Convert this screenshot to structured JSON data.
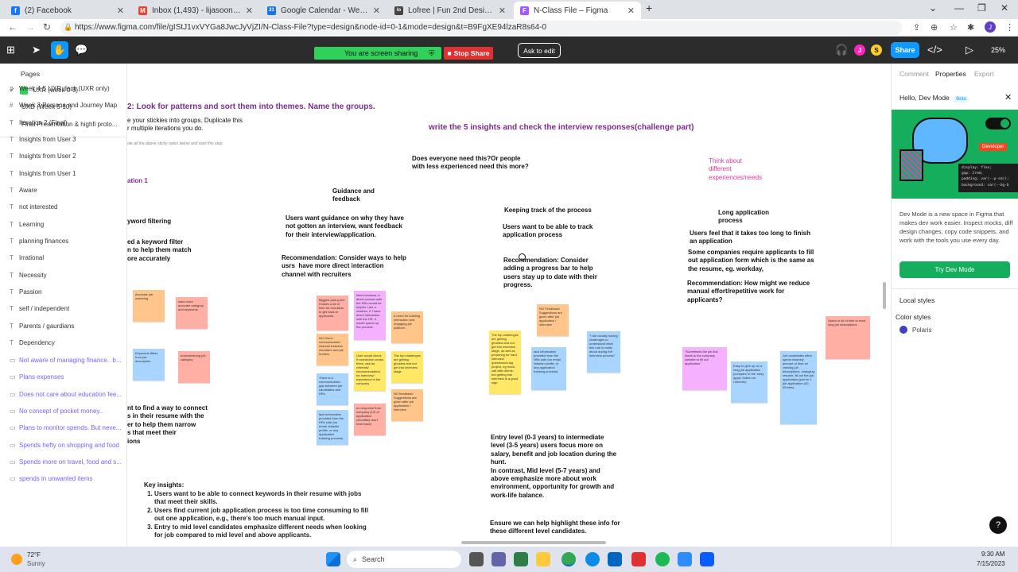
{
  "browser": {
    "tabs": [
      {
        "title": "(2) Facebook",
        "fav_color": "#1877f2",
        "fav_glyph": "f"
      },
      {
        "title": "Inbox (1,493) - lijasoon@gmail.c",
        "fav_color": "#ea4335",
        "fav_glyph": "M"
      },
      {
        "title": "Google Calendar - Week of July",
        "fav_color": "#1a73e8",
        "fav_glyph": "31"
      },
      {
        "title": "Lofree | Fun 2nd Designer for Mec",
        "fav_color": "#444444",
        "fav_glyph": "lo"
      },
      {
        "title": "N-Class File – Figma",
        "fav_color": "#a259ff",
        "fav_glyph": "F",
        "active": true
      }
    ],
    "new_tab": "+",
    "url": "https://www.figma.com/file/gIStJ1vxVYGa8JwcJyVjZI/N-Class-File?type=design&node-id=0-1&mode=design&t=B9FgXE94lzaR8s64-0",
    "profile_initial": "J"
  },
  "toolbar": {
    "screen_sharing": "You are screen sharing",
    "stop_share": "Stop Share",
    "ask_to_edit": "Ask to edit",
    "avatars": [
      {
        "initial": "J",
        "color": "#ff24bd"
      },
      {
        "initial": "S",
        "color": "#ffcd29"
      }
    ],
    "share": "Share",
    "zoom": "25%"
  },
  "pages": {
    "header": "Pages",
    "items": [
      {
        "label": "UXR (week 0-5)",
        "current": true
      },
      {
        "label": "UXD (Week 5-10)"
      },
      {
        "label": "Final Presentation & highfi proto..."
      }
    ]
  },
  "layers": [
    {
      "label": "Week 4-5 UXR deck (UXR only)",
      "icon": "#",
      "purple": false
    },
    {
      "label": "Week 3 Persona and Journey Map",
      "icon": "#",
      "purple": false
    },
    {
      "label": "Iteration 2 (Final)",
      "icon": "T",
      "purple": false
    },
    {
      "label": "Insights from User 3",
      "icon": "T",
      "purple": false
    },
    {
      "label": "Insights from User 2",
      "icon": "T",
      "purple": false
    },
    {
      "label": "Insights from User 1",
      "icon": "T",
      "purple": false
    },
    {
      "label": "Aware",
      "icon": "T",
      "purple": false
    },
    {
      "label": "not interested",
      "icon": "T",
      "purple": false
    },
    {
      "label": "Learning",
      "icon": "T",
      "purple": false
    },
    {
      "label": "planning finances",
      "icon": "T",
      "purple": false
    },
    {
      "label": "Irrational",
      "icon": "T",
      "purple": false
    },
    {
      "label": "Necessity",
      "icon": "T",
      "purple": false
    },
    {
      "label": "Passion",
      "icon": "T",
      "purple": false
    },
    {
      "label": "self / independent",
      "icon": "T",
      "purple": false
    },
    {
      "label": "Parents / gaurdians",
      "icon": "T",
      "purple": false
    },
    {
      "label": "Dependency",
      "icon": "T",
      "purple": false
    },
    {
      "label": "Not aware of managing finance.. b...",
      "icon": "▭",
      "purple": true
    },
    {
      "label": "Plans expenses",
      "icon": "▭",
      "purple": true
    },
    {
      "label": "Does not care about education fee...",
      "icon": "▭",
      "purple": true
    },
    {
      "label": "No concept of pocket money..",
      "icon": "▭",
      "purple": true
    },
    {
      "label": "Plans to monitor spends. But neve...",
      "icon": "▭",
      "purple": true
    },
    {
      "label": "Spends hefty on shopping and food",
      "icon": "▭",
      "purple": true
    },
    {
      "label": "Spends more on travel, food and s...",
      "icon": "▭",
      "purple": true
    },
    {
      "label": "spends in unwanted items",
      "icon": "▭",
      "purple": true
    }
  ],
  "canvas": {
    "step_title": "2: Look for patterns and sort them into themes. Name the groups.",
    "step_desc": "e your stickies into groups. Duplicate this\nr multiple iterations you do.",
    "step_hint": "ote all the above sticky notes below and start this step.",
    "iteration": "ation 1",
    "challenge_title": "write the 5 insights and check the interview responses(challenge part)",
    "kw_heading": "yword filtering",
    "kw_text": "ed a keyword filter\nn to help them match\nore accurately",
    "kw_bottom": "nt to find a way to connect\ns in their resume with the\ner to help them narrow\ns that meet their\nions",
    "does_everyone": "Does everyone need this?Or people\nwith less experienced need this more?",
    "guidance_heading": "Guidance and\nfeedback",
    "guidance_text": "Users want guidance on why they have\nnot gotten an interview, want feedback\nfor their interview/application.",
    "guidance_rec": "Recommendation: Consider ways to help\nusrs  have more direct interaction\nchannel with recruiters",
    "tracking_heading": "Keeping track of the process",
    "tracking_text": "Users want to be able to track\napplication process",
    "tracking_rec": "Recommendation: Consider\nadding a progress bar to help\nusers stay up to date with their\nprogress.",
    "think_about": "Think about\ndifferent\nexperiences/needs",
    "long_heading": "Long application\nprocess",
    "long_text": "Users feel that it takes too long to finish\nan application",
    "long_text2": "Some companies require applicants to fill\nout application form which is the same as\nthe resume, eg. workday,",
    "long_rec": "Recommendation: How might we reduce\nmanual effort/repetitive work for\napplicants?",
    "entry_level": "Entry level (0-3 years) to intermediate\nlevel (3-5 years) users focus more on\nsalary, benefit and job location during the\nhunt.\nIn contrast, Mid level (5-7 years) and\nabove emphasize more about work\nenvironment, opportunity for growth and\nwork-life balance.",
    "ensure": "Ensure we can help highlight these info for\nthese different level candidates.",
    "key_insights_title": "Key insights:",
    "key_insights": [
      "Users want to be able to connect keywords in their resume with jobs that meet their skills.",
      "Users find current job application process is too time consuming to fill out one application, e.g., there's too much manual input.",
      "Entry to mid level candidates emphasize different needs when looking for job compared to mid level and above applicants."
    ],
    "stickies": [
      {
        "text": "Accurate job matching",
        "color": "or"
      },
      {
        "text": "want more accurate category and keywords",
        "color": "pk"
      },
      {
        "text": "Keywords filters from job description",
        "color": "bl"
      },
      {
        "text": "unclear/wrong job category",
        "color": "pk"
      },
      {
        "text": "Biggest pain point: it takes a lot of time for recruiters to get back to applicants.",
        "color": "pk"
      },
      {
        "text": "New functions: a direct contact with the HRs would be helpful. Like a chatbox. If I have direct interaction with the HR, it would speed up the process.",
        "color": "vl"
      },
      {
        "text": "A need for building interaction and engaging job platform",
        "color": "or"
      },
      {
        "text": "NO Direct communication channel between recruiters and job hunters",
        "color": "or"
      },
      {
        "text": "User would check if connection works there, ask for referrals/ recommendation for interview/ experience in the company",
        "color": "yl"
      },
      {
        "text": "The top challenges are getting ghosted and not get into interview stage",
        "color": "yl"
      },
      {
        "text": "There is a communication gap between job candidates and HRs",
        "color": "bl"
      },
      {
        "text": "NO feedback/ Suggestions are given after job application / interview",
        "color": "or"
      },
      {
        "text": "lack information provided from the HRs side (no email, linkedin profile, or any application tracking process)",
        "color": "bl"
      },
      {
        "text": "no response from company (1/3 of application submitted don't hear back)",
        "color": "pk"
      },
      {
        "text": "NO Feedback/ Suggestions are given after job application / interview",
        "color": "or"
      },
      {
        "text": "The top challenges are getting ghosted and not get into interview stage, as well as preparing for hard interview questions/a big project, eg mock call with clients, but getting into interview is a good sign.",
        "color": "yl"
      },
      {
        "text": "lack information provided from the HRs side (no email, linkedin profile, or any application tracking process)",
        "color": "bl"
      },
      {
        "text": "\"I am usually having challenges to understand what this role is really about during the interview process\"",
        "color": "bl"
      },
      {
        "text": "\"Sometimes the job link leads to the company website to fill out application\"",
        "color": "vl"
      },
      {
        "text": "Easy to give up on a long job application (compare to the 'easy apply' button on LinkedIn)",
        "color": "bl"
      },
      {
        "text": "Job candidates often spend insanely amount of time on viewing job descriptions, changing resume, fill out the job application (just for 1 job application (40-50mins)",
        "color": "bl"
      },
      {
        "text": "Spend a lot of time to read long job descriptions",
        "color": "pk"
      }
    ]
  },
  "right_panel": {
    "tabs": [
      "Comment",
      "Properties",
      "Export"
    ],
    "active_tab": "Properties",
    "hello": "Hello, Dev Mode",
    "beta": "Beta",
    "developer_tag": "Developer",
    "code_lines": [
      "display: flex;",
      "gap: 2rem;",
      "padding: var(--p-sm));",
      "background: var(--bg-b"
    ],
    "description": "Dev Mode is a new space in Figma that makes dev work easier. Inspect mocks, diff design changes, copy code snippets, and work with the tools you use every day.",
    "try_button": "Try Dev Mode",
    "local_styles": "Local styles",
    "color_styles": "Color styles",
    "style_name": "Polaris",
    "style_color": "#3f3fbf",
    "help": "?"
  },
  "taskbar": {
    "weather_temp": "72°F",
    "weather_desc": "Sunny",
    "search": "Search",
    "time": "9:30 AM",
    "date": "7/15/2023"
  }
}
